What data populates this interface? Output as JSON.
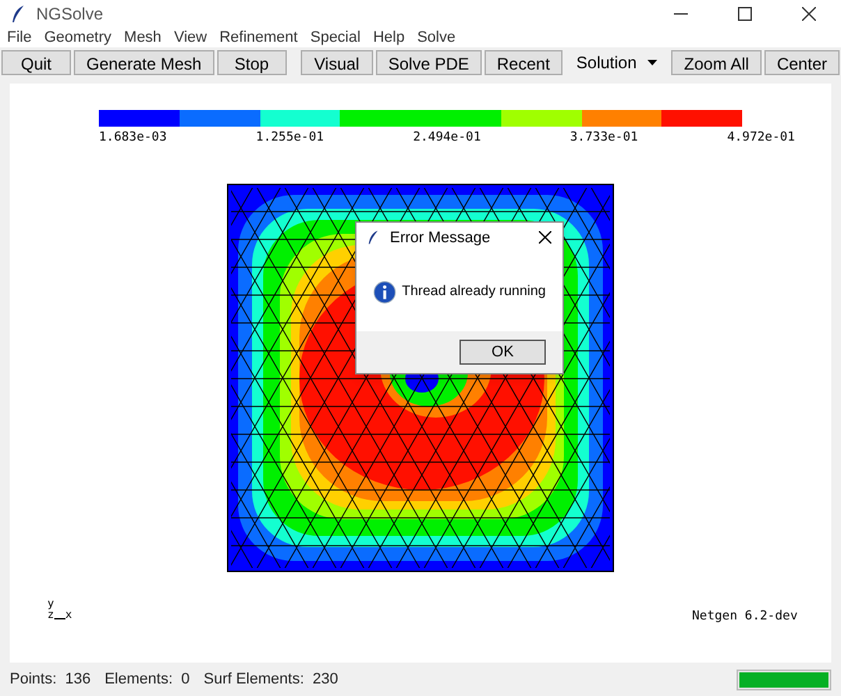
{
  "window": {
    "title": "NGSolve"
  },
  "menu": [
    "File",
    "Geometry",
    "Mesh",
    "View",
    "Refinement",
    "Special",
    "Help",
    "Solve"
  ],
  "toolbar_left": [
    "Quit",
    "Generate Mesh",
    "Stop"
  ],
  "toolbar_right": [
    {
      "kind": "button",
      "label": "Visual"
    },
    {
      "kind": "button",
      "label": "Solve PDE"
    },
    {
      "kind": "button",
      "label": "Recent"
    },
    {
      "kind": "dropdown",
      "label": "Solution"
    },
    {
      "kind": "button",
      "label": "Zoom All"
    },
    {
      "kind": "button",
      "label": "Center"
    }
  ],
  "colorbar": {
    "segments": [
      {
        "color": "#0000ff"
      },
      {
        "color": "#0a6cff"
      },
      {
        "color": "#14ffd0"
      },
      {
        "color": "#00f000"
      },
      {
        "color": "#00f000"
      },
      {
        "color": "#a0ff00"
      },
      {
        "color": "#ff8000"
      },
      {
        "color": "#ff1000"
      }
    ],
    "labels": [
      "1.683e-03",
      "1.255e-01",
      "2.494e-01",
      "3.733e-01",
      "4.972e-01"
    ]
  },
  "axes": {
    "y": "y",
    "z": "z",
    "x": "x"
  },
  "version": "Netgen 6.2-dev",
  "dialog": {
    "title": "Error Message",
    "message": "Thread already running",
    "button": "OK"
  },
  "status_bar": {
    "items": [
      "Points:  136",
      "Elements:  0",
      "Surf Elements:  230"
    ],
    "progress": {
      "level": 1
    }
  }
}
